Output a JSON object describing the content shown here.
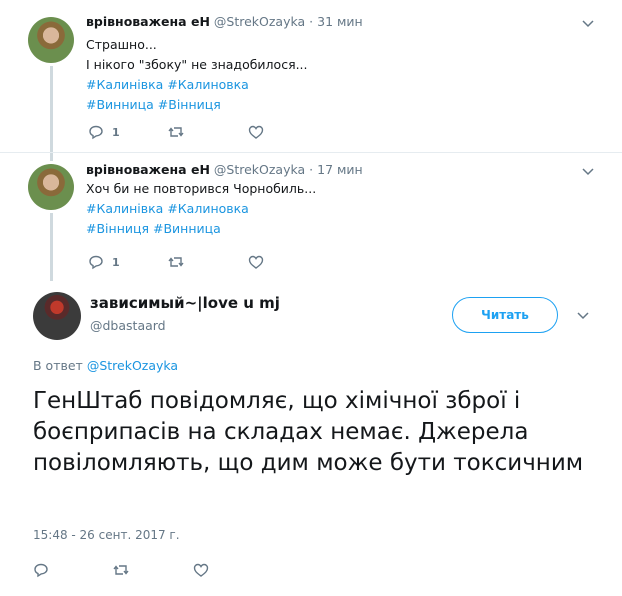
{
  "tweets": [
    {
      "name": "врівноважена еН",
      "handle": "@StrekOzayka",
      "time": "31 мин",
      "lines": [
        "Страшно...",
        "І нікого \"збоку\" не знадобилося..."
      ],
      "tags_line1": "#Калинівка #Калиновка",
      "tags_line2": "#Винница #Вінниця",
      "reply_count": "1"
    },
    {
      "name": "врівноважена еН",
      "handle": "@StrekOzayka",
      "time": "17 мин",
      "lines": [
        "Хоч би не повторився Чорнобиль..."
      ],
      "tags_line1": "#Калинівка #Калиновка",
      "tags_line2": "#Вінниця #Винница",
      "reply_count": "1"
    }
  ],
  "main": {
    "name": "зависимый~|love u mj",
    "handle": "@dbastaard",
    "follow_label": "Читать",
    "reply_prefix": "В ответ",
    "reply_handle": "@StrekOzayka",
    "text": "ГенШтаб повідомляє, що хімічної зброї і боєприпасів на складах немає. Джерела повіломляють, що дим може бути токсичним",
    "timestamp": "15:48 - 26 сент. 2017 г."
  },
  "colors": {
    "link": "#1b95e0",
    "accent": "#1da1f2",
    "muted": "#657786",
    "thread_line": "#cfd9de"
  },
  "icons": [
    "reply-icon",
    "retweet-icon",
    "like-icon",
    "chevron-down-icon"
  ]
}
